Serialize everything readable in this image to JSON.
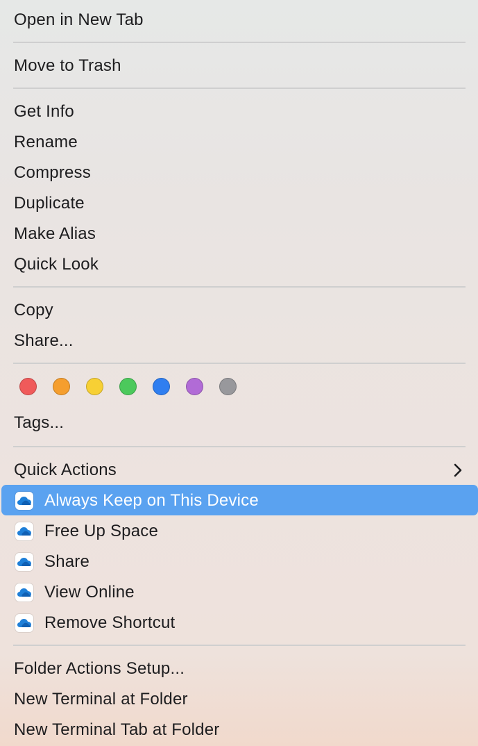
{
  "menu": {
    "open_in_new_tab": "Open in New Tab",
    "move_to_trash": "Move to Trash",
    "get_info": "Get Info",
    "rename": "Rename",
    "compress": "Compress",
    "duplicate": "Duplicate",
    "make_alias": "Make Alias",
    "quick_look": "Quick Look",
    "copy": "Copy",
    "share": "Share...",
    "tags": "Tags...",
    "quick_actions": "Quick Actions",
    "onedrive": {
      "icon": "onedrive-cloud-icon",
      "always_keep": "Always Keep on This Device",
      "free_up_space": "Free Up Space",
      "share": "Share",
      "view_online": "View Online",
      "remove_shortcut": "Remove Shortcut"
    },
    "folder_actions_setup": "Folder Actions Setup...",
    "new_terminal_at_folder": "New Terminal at Folder",
    "new_terminal_tab_at_folder": "New Terminal Tab at Folder"
  },
  "tag_colors": {
    "red": "#f05a5a",
    "orange": "#f59e2e",
    "yellow": "#f7d034",
    "green": "#4cc95c",
    "blue": "#2f7ef0",
    "purple": "#b16bd6",
    "gray": "#98989c"
  },
  "colors": {
    "highlight": "#5aa2f0",
    "separator": "#cfcfcf",
    "text": "#1d1d1f"
  }
}
